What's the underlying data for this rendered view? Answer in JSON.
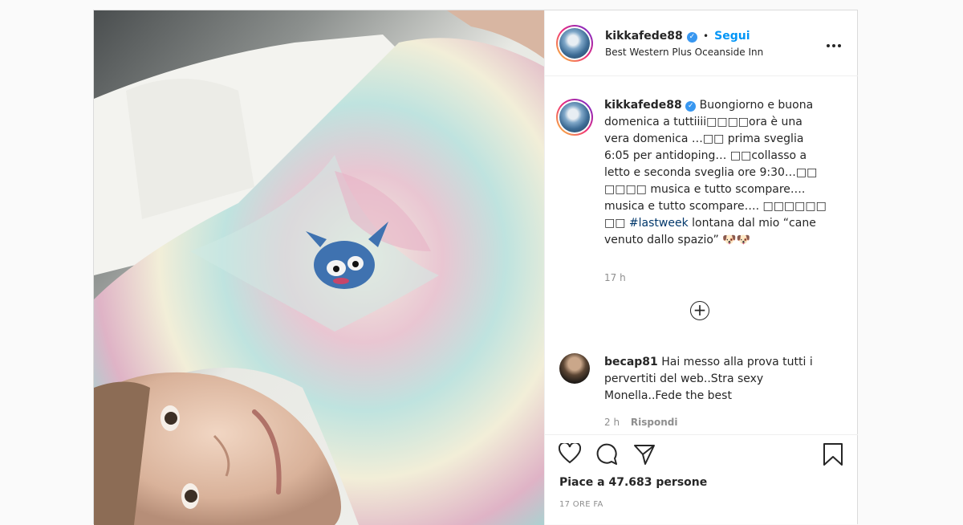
{
  "post": {
    "username": "kikkafede88",
    "verified_icon": "verified-icon",
    "follow_separator": "•",
    "follow_label": "Segui",
    "location": "Best Western Plus Oceanside Inn",
    "more_label": "•••"
  },
  "caption": {
    "username": "kikkafede88",
    "text_before_hashtag": "Buongiorno e buona domenica a tuttiiii□□□□ora è una vera domenica …□□ prima sveglia 6:05 per antidoping… □□collasso a letto e seconda sveglia ore 9:30…□□ □□□□ musica e tutto scompare…. musica e tutto scompare…. □□□□□□ □□",
    "hashtag": "#lastweek",
    "text_after_hashtag": "lontana dal mio “cane venuto dallo spazio” 🐶🐶",
    "time": "17 h"
  },
  "comment": {
    "username": "becap81",
    "text": "Hai messo alla prova tutti i pervertiti del web..Stra sexy Monella..Fede the best",
    "time": "2 h",
    "reply_label": "Rispondi"
  },
  "footer": {
    "likes": "Piace a 47.683 persone",
    "date": "17 ORE FA"
  },
  "colors": {
    "accent": "#0095f6",
    "verified": "#3897f0",
    "muted": "#8e8e8e"
  }
}
